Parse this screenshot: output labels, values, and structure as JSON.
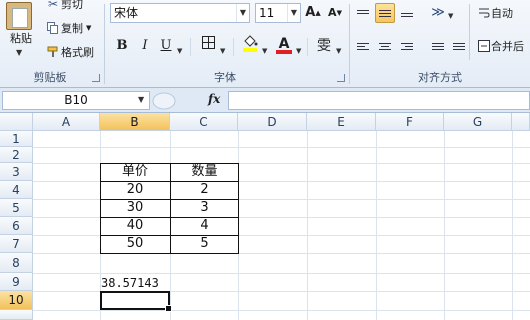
{
  "ribbon": {
    "clipboard": {
      "paste_label": "粘贴",
      "cut_label": "剪切",
      "copy_label": "复制",
      "format_painter_label": "格式刷",
      "group_label": "剪贴板"
    },
    "font": {
      "font_name": "宋体",
      "font_size": "11",
      "grow_label": "A",
      "shrink_label": "A",
      "bold_label": "B",
      "italic_label": "I",
      "underline_label": "U",
      "font_color_label": "A",
      "phonetic_label": "雯",
      "group_label": "字体",
      "font_color": "#e02020",
      "fill_color": "#ffff00"
    },
    "alignment": {
      "wrap_text_label": "自动",
      "merge_label": "合并后",
      "group_label": "对齐方式"
    }
  },
  "formula_bar": {
    "name_box": "B10",
    "fx_label": "fx",
    "formula": ""
  },
  "sheet": {
    "columns": [
      "A",
      "B",
      "C",
      "D",
      "E",
      "F",
      "G"
    ],
    "rows": [
      "1",
      "2",
      "3",
      "4",
      "5",
      "6",
      "7",
      "8",
      "9",
      "10"
    ],
    "table": {
      "headers": [
        "单价",
        "数量"
      ],
      "rows": [
        [
          "20",
          "2"
        ],
        [
          "30",
          "3"
        ],
        [
          "40",
          "4"
        ],
        [
          "50",
          "5"
        ]
      ]
    },
    "result_value": "38.57143",
    "active_cell": "B10"
  }
}
